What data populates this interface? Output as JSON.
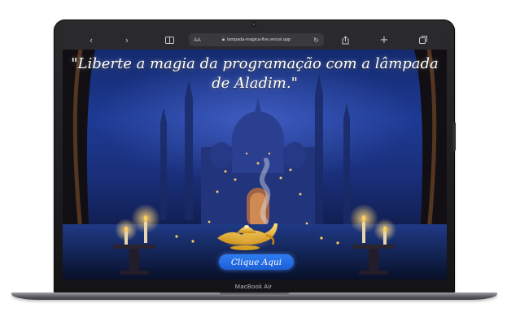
{
  "device": {
    "label": "MacBook Air"
  },
  "browser": {
    "text_size_label": "AA",
    "url": "lampada-magica-five.vercel.app",
    "icons": {
      "back": "chevron-left-icon",
      "forward": "chevron-right-icon",
      "sidebar": "book-icon",
      "lock": "lock-icon",
      "reload": "reload-icon",
      "share": "share-icon",
      "new_tab": "plus-icon",
      "tabs": "tabs-icon"
    }
  },
  "page": {
    "headline": "\"Liberte a magia da programação com a lâmpada de Aladim.\"",
    "button_label": "Clique Aqui"
  },
  "colors": {
    "button": "#1c5fd6",
    "sky": "#1d3a93",
    "lamp": "#e9b21c",
    "flame": "#ffcf5a"
  }
}
